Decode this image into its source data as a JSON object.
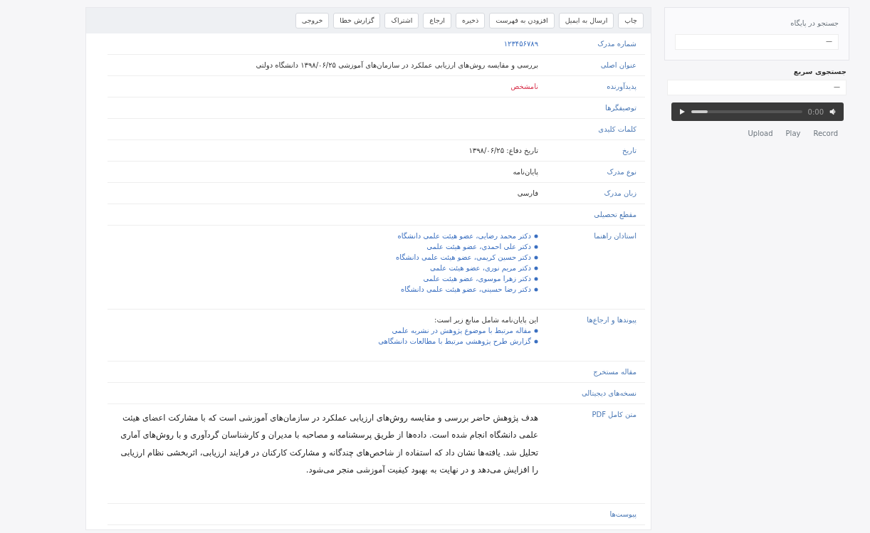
{
  "toolbar": [
    "چاپ",
    "ارسال به ایمیل",
    "افزودن به فهرست",
    "ذخیره",
    "ارجاع",
    "اشتراک",
    "گزارش خطا",
    "خروجی"
  ],
  "record": [
    {
      "label": "شماره مدرک",
      "kind": "link",
      "value": "۱۲۳۴۵۶۷۸۹"
    },
    {
      "label": "عنوان اصلی",
      "kind": "text",
      "value": "بررسی و مقایسه روش‌های ارزیابی عملکرد در سازمان‌های آموزشی ۱۳۹۸/۰۶/۲۵ دانشگاه دولتی"
    },
    {
      "label": "پدیدآورنده",
      "kind": "alert",
      "value": "نامشخص"
    },
    {
      "label": "توصیفگرها",
      "kind": "empty"
    },
    {
      "label": "کلمات کلیدی",
      "kind": "empty"
    },
    {
      "label": "تاریخ",
      "kind": "text",
      "value": "تاریخ دفاع: ۱۳۹۸/۰۶/۲۵"
    },
    {
      "label": "نوع مدرک",
      "kind": "text",
      "value": "پایان‌نامه"
    },
    {
      "label": "زبان مدرک",
      "kind": "text",
      "value": "فارسی"
    },
    {
      "label": "مقطع تحصیلی",
      "kind": "empty"
    },
    {
      "label": "استادان راهنما",
      "kind": "list",
      "items": [
        "دکتر محمد رضایی، عضو هیئت علمی دانشگاه",
        "دکتر علی احمدی، عضو هیئت علمی",
        "دکتر حسین کریمی، عضو هیئت علمی دانشگاه",
        "دکتر مریم نوری، عضو هیئت علمی",
        "دکتر زهرا موسوی، عضو هیئت علمی",
        "دکتر رضا حسینی، عضو هیئت علمی دانشگاه"
      ]
    },
    {
      "label": "پیوندها و ارجاع‌ها",
      "kind": "list",
      "intro": "این پایان‌نامه شامل منابع زیر است:",
      "items": [
        "مقاله مرتبط با موضوع پژوهش در نشریه علمی",
        "گزارش طرح پژوهشی مرتبط با مطالعات دانشگاهی"
      ]
    },
    {
      "label": "مقاله مستخرج",
      "kind": "empty"
    },
    {
      "label": "نسخه‌های دیجیتالی",
      "kind": "empty"
    },
    {
      "label": "متن کامل PDF",
      "kind": "paragraph",
      "value": "هدف پژوهش حاضر بررسی و مقایسه روش‌های ارزیابی عملکرد در سازمان‌های آموزشی است که با مشارکت اعضای هیئت علمی دانشگاه انجام شده است. داده‌ها از طریق پرسشنامه و مصاحبه با مدیران و کارشناسان گردآوری و با روش‌های آماری تحلیل شد. یافته‌ها نشان داد که استفاده از شاخص‌های چندگانه و مشارکت کارکنان در فرایند ارزیابی، اثربخشی نظام ارزیابی را افزایش می‌دهد و در نهایت به بهبود کیفیت آموزشی منجر می‌شود."
    },
    {
      "label": "پیوست‌ها",
      "kind": "empty"
    }
  ],
  "sidebar": {
    "box_label": "جستجو در پایگاه",
    "box_value": "—",
    "search_label": "جستجوی سریع",
    "search_value": "—",
    "player": {
      "time": "0:00",
      "level": 0.15
    },
    "links": [
      "Record",
      "Play",
      "Upload"
    ]
  }
}
